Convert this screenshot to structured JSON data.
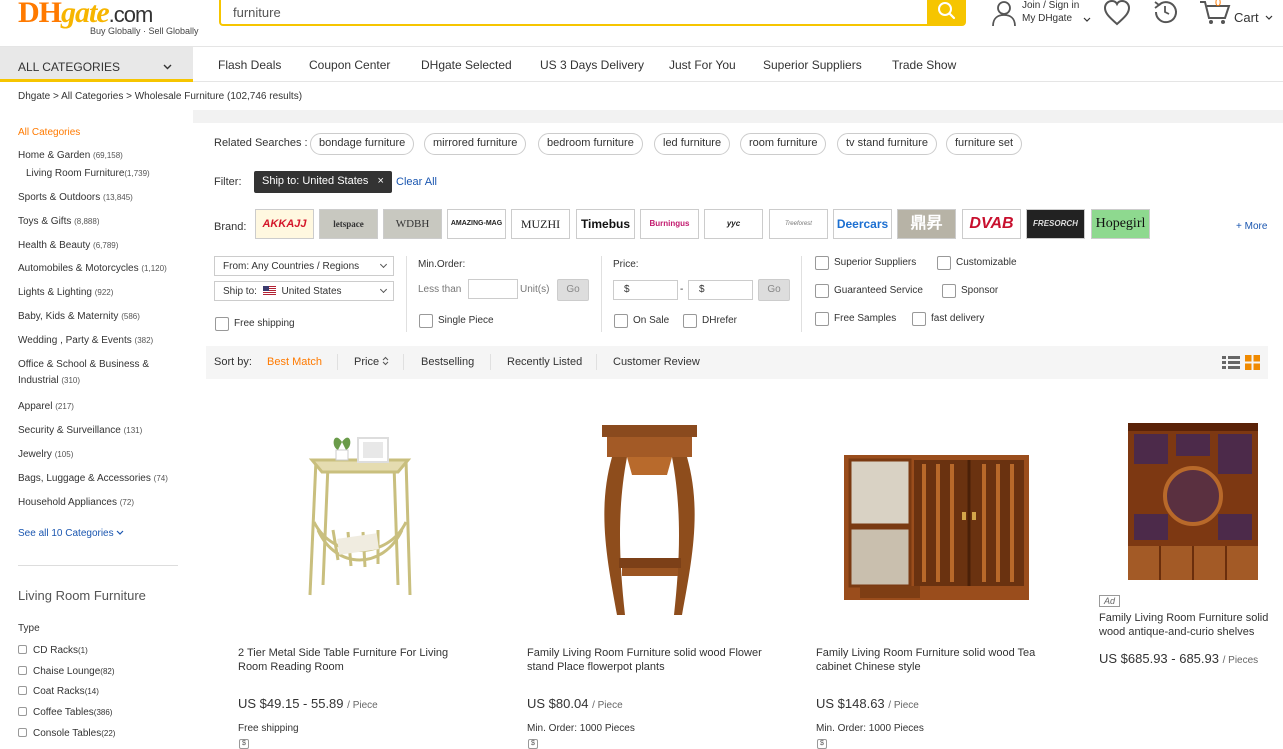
{
  "header": {
    "logo_dh": "DH",
    "logo_gate": "gate",
    "logo_com": ".com",
    "tagline": "Buy Globally · Sell Globally",
    "search_value": "furniture",
    "signin_line1": "Join / Sign in",
    "signin_line2": "My DHgate",
    "cart_count": "0",
    "cart_label": "Cart",
    "accent": "#f6c500"
  },
  "nav": {
    "all_categories": "ALL CATEGORIES",
    "items": [
      "Flash Deals",
      "Coupon Center",
      "DHgate Selected",
      "US 3 Days Delivery",
      "Just For You",
      "Superior Suppliers",
      "Trade Show"
    ]
  },
  "breadcrumb": "Dhgate > All Categories > Wholesale Furniture (102,746 results)",
  "sidebar": {
    "all_categories": "All Categories",
    "categories": [
      {
        "label": "Home & Garden",
        "count": "(69,158)"
      },
      {
        "label": "Living Room Furniture",
        "count": "(1,739)"
      },
      {
        "label": "Sports & Outdoors",
        "count": "(13,845)"
      },
      {
        "label": "Toys & Gifts",
        "count": "(8,888)"
      },
      {
        "label": "Health & Beauty",
        "count": "(6,789)"
      },
      {
        "label": "Automobiles & Motorcycles",
        "count": "(1,120)"
      },
      {
        "label": "Lights & Lighting",
        "count": "(922)"
      },
      {
        "label": "Baby, Kids & Maternity",
        "count": "(586)"
      },
      {
        "label": "Wedding , Party & Events",
        "count": "(382)"
      },
      {
        "label": "Office & School & Business & Industrial",
        "count": "(310)"
      },
      {
        "label": "Apparel",
        "count": "(217)"
      },
      {
        "label": "Security & Surveillance",
        "count": "(131)"
      },
      {
        "label": "Jewelry",
        "count": "(105)"
      },
      {
        "label": "Bags, Luggage & Accessories",
        "count": "(74)"
      },
      {
        "label": "Household Appliances",
        "count": "(72)"
      }
    ],
    "see_all": "See all 10 Categories",
    "section_title": "Living Room Furniture",
    "type_label": "Type",
    "types": [
      {
        "label": "CD Racks",
        "count": "(1)"
      },
      {
        "label": "Chaise Lounge",
        "count": "(82)"
      },
      {
        "label": "Coat Racks",
        "count": "(14)"
      },
      {
        "label": "Coffee Tables",
        "count": "(386)"
      },
      {
        "label": "Console Tables",
        "count": "(22)"
      }
    ]
  },
  "related": {
    "label": "Related Searches :",
    "chips": [
      "bondage furniture",
      "mirrored furniture",
      "bedroom furniture",
      "led furniture",
      "room furniture",
      "tv stand furniture",
      "furniture set"
    ]
  },
  "filter": {
    "label": "Filter:",
    "tag": "Ship to: United States",
    "clear_all": "Clear All"
  },
  "brand": {
    "label": "Brand:",
    "brands": [
      "AKKAJJ",
      "letspace",
      "WDBH",
      "AMAZING-MAG",
      "MUZHI",
      "Timebus",
      "Burningus",
      "yyc",
      "Treeforest",
      "Deercars",
      "鼎昇",
      "DVAB",
      "FRESORCH",
      "Hopegirl"
    ],
    "more": "+ More"
  },
  "options": {
    "from": "From: Any Countries / Regions",
    "ship_to_prefix": "Ship to:",
    "ship_to": "United States",
    "free_shipping": "Free shipping",
    "min_order_label": "Min.Order:",
    "less_than": "Less than",
    "units": "Unit(s)",
    "go": "Go",
    "single_piece": "Single Piece",
    "price_label": "Price:",
    "price_from": "$",
    "price_to": "$",
    "on_sale": "On Sale",
    "dhrefer": "DHrefer",
    "superior_suppliers": "Superior Suppliers",
    "customizable": "Customizable",
    "guaranteed_service": "Guaranteed Service",
    "sponsor": "Sponsor",
    "free_samples": "Free Samples",
    "fast_delivery": "fast delivery"
  },
  "sort": {
    "label": "Sort by:",
    "best_match": "Best Match",
    "price": "Price",
    "bestselling": "Bestselling",
    "recently_listed": "Recently Listed",
    "customer_review": "Customer Review"
  },
  "products": [
    {
      "title": "2 Tier Metal Side Table Furniture For Living Room Reading Room",
      "price": "US $49.15 - 55.89",
      "unit": "/ Piece",
      "sub": "Free shipping"
    },
    {
      "title": "Family Living Room Furniture solid wood Flower stand Place flowerpot plants",
      "price": "US $80.04",
      "unit": "/ Piece",
      "sub": "Min. Order: 1000 Pieces"
    },
    {
      "title": "Family Living Room Furniture solid wood Tea cabinet Chinese style",
      "price": "US $148.63",
      "unit": "/ Piece",
      "sub": "Min. Order: 1000 Pieces"
    },
    {
      "title": "Family Living Room Furniture solid wood antique-and-curio shelves",
      "price": "US $685.93 - 685.93",
      "unit": "/ Pieces",
      "ad": "Ad"
    }
  ]
}
